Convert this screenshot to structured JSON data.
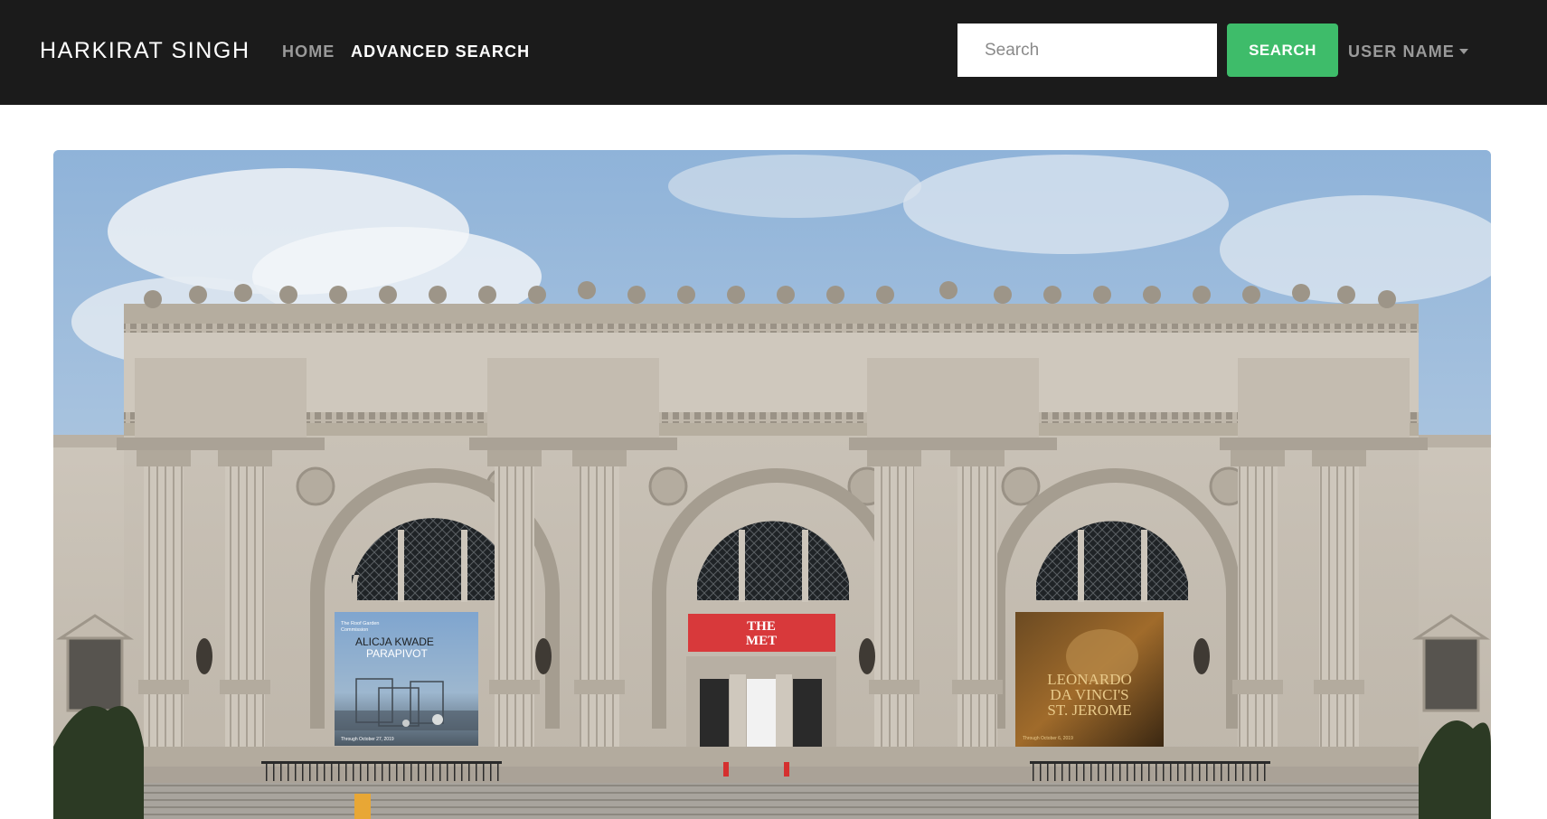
{
  "navbar": {
    "brand": "HARKIRAT SINGH",
    "links": [
      {
        "label": "HOME"
      },
      {
        "label": "ADVANCED SEARCH"
      }
    ],
    "search": {
      "placeholder": "Search",
      "button_label": "SEARCH"
    },
    "user_menu": {
      "label": "USER NAME"
    }
  },
  "hero": {
    "banners": {
      "left": {
        "kicker_line1": "The Roof Garden",
        "kicker_line2": "Commission",
        "title_line1": "ALICJA KWADE",
        "title_line2": "PARAPIVOT",
        "date": "Through October 27, 2019"
      },
      "center": {
        "line1": "THE",
        "line2": "MET"
      },
      "right": {
        "title_line1": "LEONARDO",
        "title_line2": "DA VINCI'S",
        "title_line3": "ST. JEROME",
        "date": "Through October 6, 2019"
      }
    },
    "colors": {
      "navbar_bg": "#1b1b1b",
      "search_button": "#3ebc6a",
      "met_red": "#d8393b"
    }
  }
}
